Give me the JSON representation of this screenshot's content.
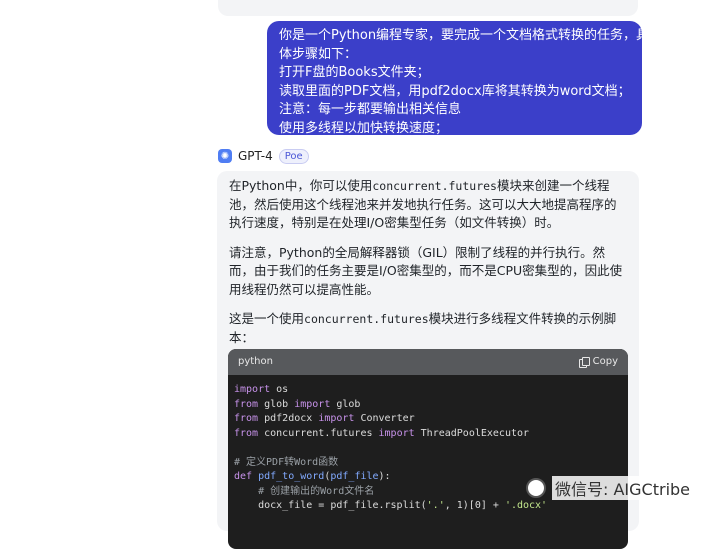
{
  "user_message": {
    "lines": [
      "你是一个Python编程专家，要完成一个文档格式转换的任务，具",
      "体步骤如下：",
      "打开F盘的Books文件夹；",
      "读取里面的PDF文档，用pdf2docx库将其转换为word文档；",
      "注意：每一步都要输出相关信息",
      "使用多线程以加快转换速度；"
    ]
  },
  "bot": {
    "name": "GPT-4",
    "badge": "Poe",
    "p1_a": "在Python中，你可以使用",
    "p1_code": "concurrent.futures",
    "p1_b": "模块来创建一个线程池，然后使用这个线程池来并发地执行任务。这可以大大地提高程序的执行速度，特别是在处理I/O密集型任务（如文件转换）时。",
    "p2": "请注意，Python的全局解释器锁（GIL）限制了线程的并行执行。然而，由于我们的任务主要是I/O密集型的，而不是CPU密集型的，因此使用线程仍然可以提高性能。",
    "p3_a": "这是一个使用",
    "p3_code": "concurrent.futures",
    "p3_b": "模块进行多线程文件转换的示例脚本："
  },
  "code_block": {
    "language": "python",
    "copy_label": "Copy",
    "lines": [
      [
        [
          "kw",
          "import"
        ],
        [
          "t",
          " os"
        ]
      ],
      [
        [
          "kw",
          "from"
        ],
        [
          "t",
          " glob "
        ],
        [
          "kw",
          "import"
        ],
        [
          "t",
          " glob"
        ]
      ],
      [
        [
          "kw",
          "from"
        ],
        [
          "t",
          " pdf2docx "
        ],
        [
          "kw",
          "import"
        ],
        [
          "t",
          " Converter"
        ]
      ],
      [
        [
          "kw",
          "from"
        ],
        [
          "t",
          " concurrent.futures "
        ],
        [
          "kw",
          "import"
        ],
        [
          "t",
          " ThreadPoolExecutor"
        ]
      ],
      [
        [
          "t",
          ""
        ]
      ],
      [
        [
          "cm",
          "# 定义PDF转Word函数"
        ]
      ],
      [
        [
          "kw",
          "def"
        ],
        [
          "t",
          " "
        ],
        [
          "fn",
          "pdf_to_word"
        ],
        [
          "t",
          "("
        ],
        [
          "fn",
          "pdf_file"
        ],
        [
          "t",
          "):"
        ]
      ],
      [
        [
          "t",
          "    "
        ],
        [
          "cm",
          "# 创建输出的Word文件名"
        ]
      ],
      [
        [
          "t",
          "    docx_file = pdf_file.rsplit("
        ],
        [
          "str",
          "'.'"
        ],
        [
          "t",
          ", 1)[0] + "
        ],
        [
          "str",
          "'.docx'"
        ]
      ]
    ]
  },
  "watermark": {
    "text": "微信号: AIGCtribe",
    "icon": "wechat-icon"
  }
}
